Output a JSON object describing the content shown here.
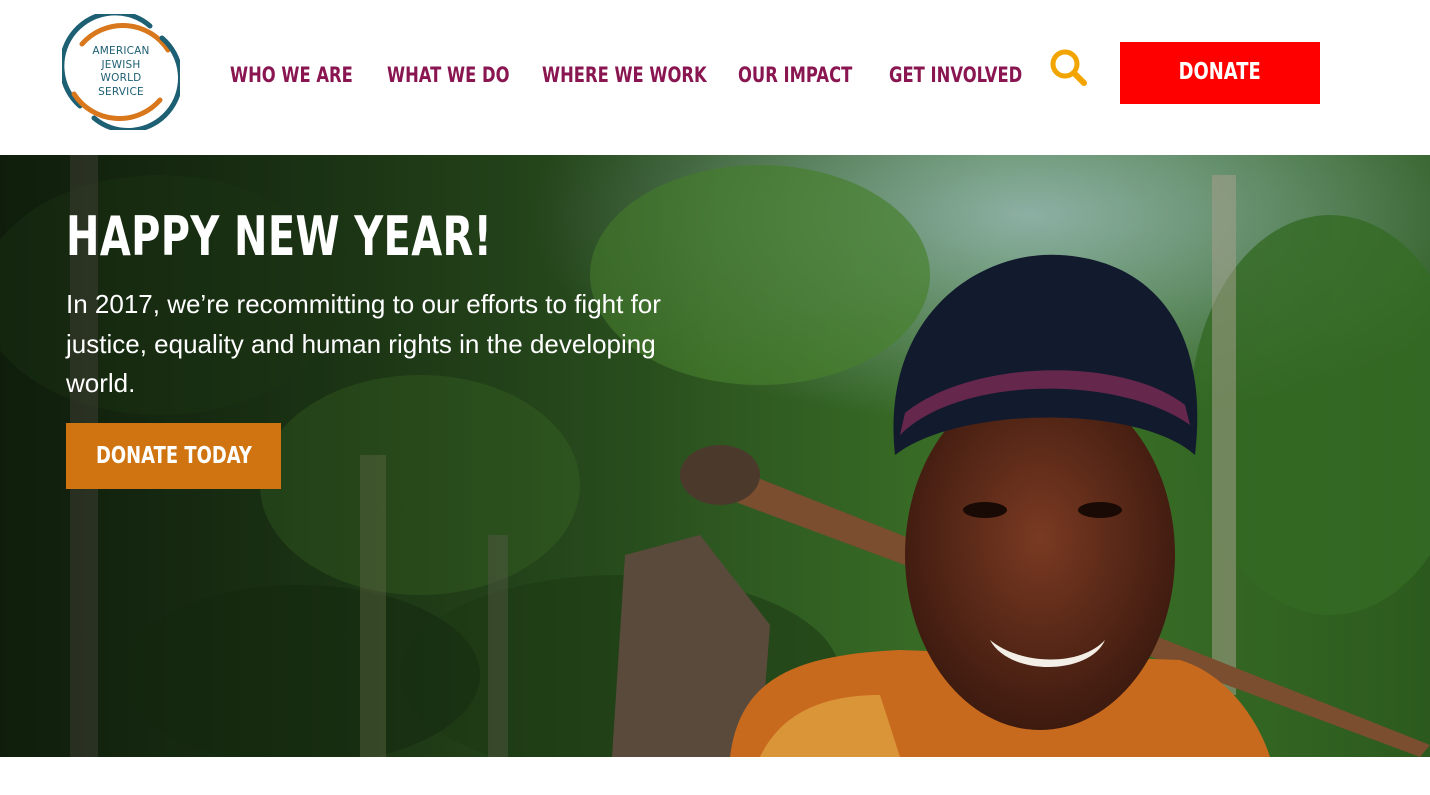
{
  "header": {
    "logo_lines": [
      "AMERICAN",
      "JEWISH",
      "WORLD",
      "SERVICE"
    ],
    "nav": [
      {
        "label": "WHO WE ARE"
      },
      {
        "label": "WHAT WE DO"
      },
      {
        "label": "WHERE WE WORK"
      },
      {
        "label": "OUR IMPACT"
      },
      {
        "label": "GET INVOLVED"
      }
    ],
    "search_icon": "search-icon",
    "donate_label": "DONATE"
  },
  "hero": {
    "title": "HAPPY NEW YEAR!",
    "body": "In 2017, we’re recommitting to our efforts to fight for justice, equality and human rights in the developing world.",
    "cta_label": "DONATE TODAY"
  },
  "colors": {
    "nav_text": "#8a1651",
    "donate_bg": "#ff0000",
    "cta_bg": "#cf7410",
    "logo_teal": "#1d5f73",
    "logo_orange": "#d9771c",
    "search_icon": "#f2a500"
  }
}
